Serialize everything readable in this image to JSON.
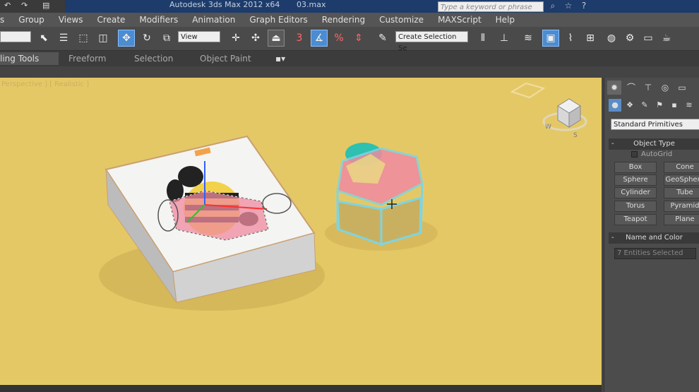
{
  "window": {
    "title": "Autodesk 3ds Max  2012 x64",
    "file": "03.max",
    "search_placeholder": "Type a keyword or phrase"
  },
  "menu": [
    "s",
    "Group",
    "Views",
    "Create",
    "Modifiers",
    "Animation",
    "Graph Editors",
    "Rendering",
    "Customize",
    "MAXScript",
    "Help"
  ],
  "toolbar": {
    "reference_coord": "View",
    "selection_set": "Create Selection Se"
  },
  "ribbon": {
    "tabs": [
      "ling Tools",
      "Freeform",
      "Selection",
      "Object Paint"
    ]
  },
  "viewport": {
    "label": "Perspective ] [ Realistic ]",
    "background": "#e5c866"
  },
  "command_panel": {
    "category": "Standard Primitives",
    "object_type_title": "Object Type",
    "autogrid_label": "AutoGrid",
    "buttons": [
      "Box",
      "Cone",
      "Sphere",
      "GeoSphere",
      "Cylinder",
      "Tube",
      "Torus",
      "Pyramid",
      "Teapot",
      "Plane"
    ],
    "name_color_title": "Name and Color",
    "name_field_value": "7 Entities Selected"
  },
  "colors": {
    "accent": "#4c8cd0",
    "titlebar": "#1d3b6b"
  }
}
